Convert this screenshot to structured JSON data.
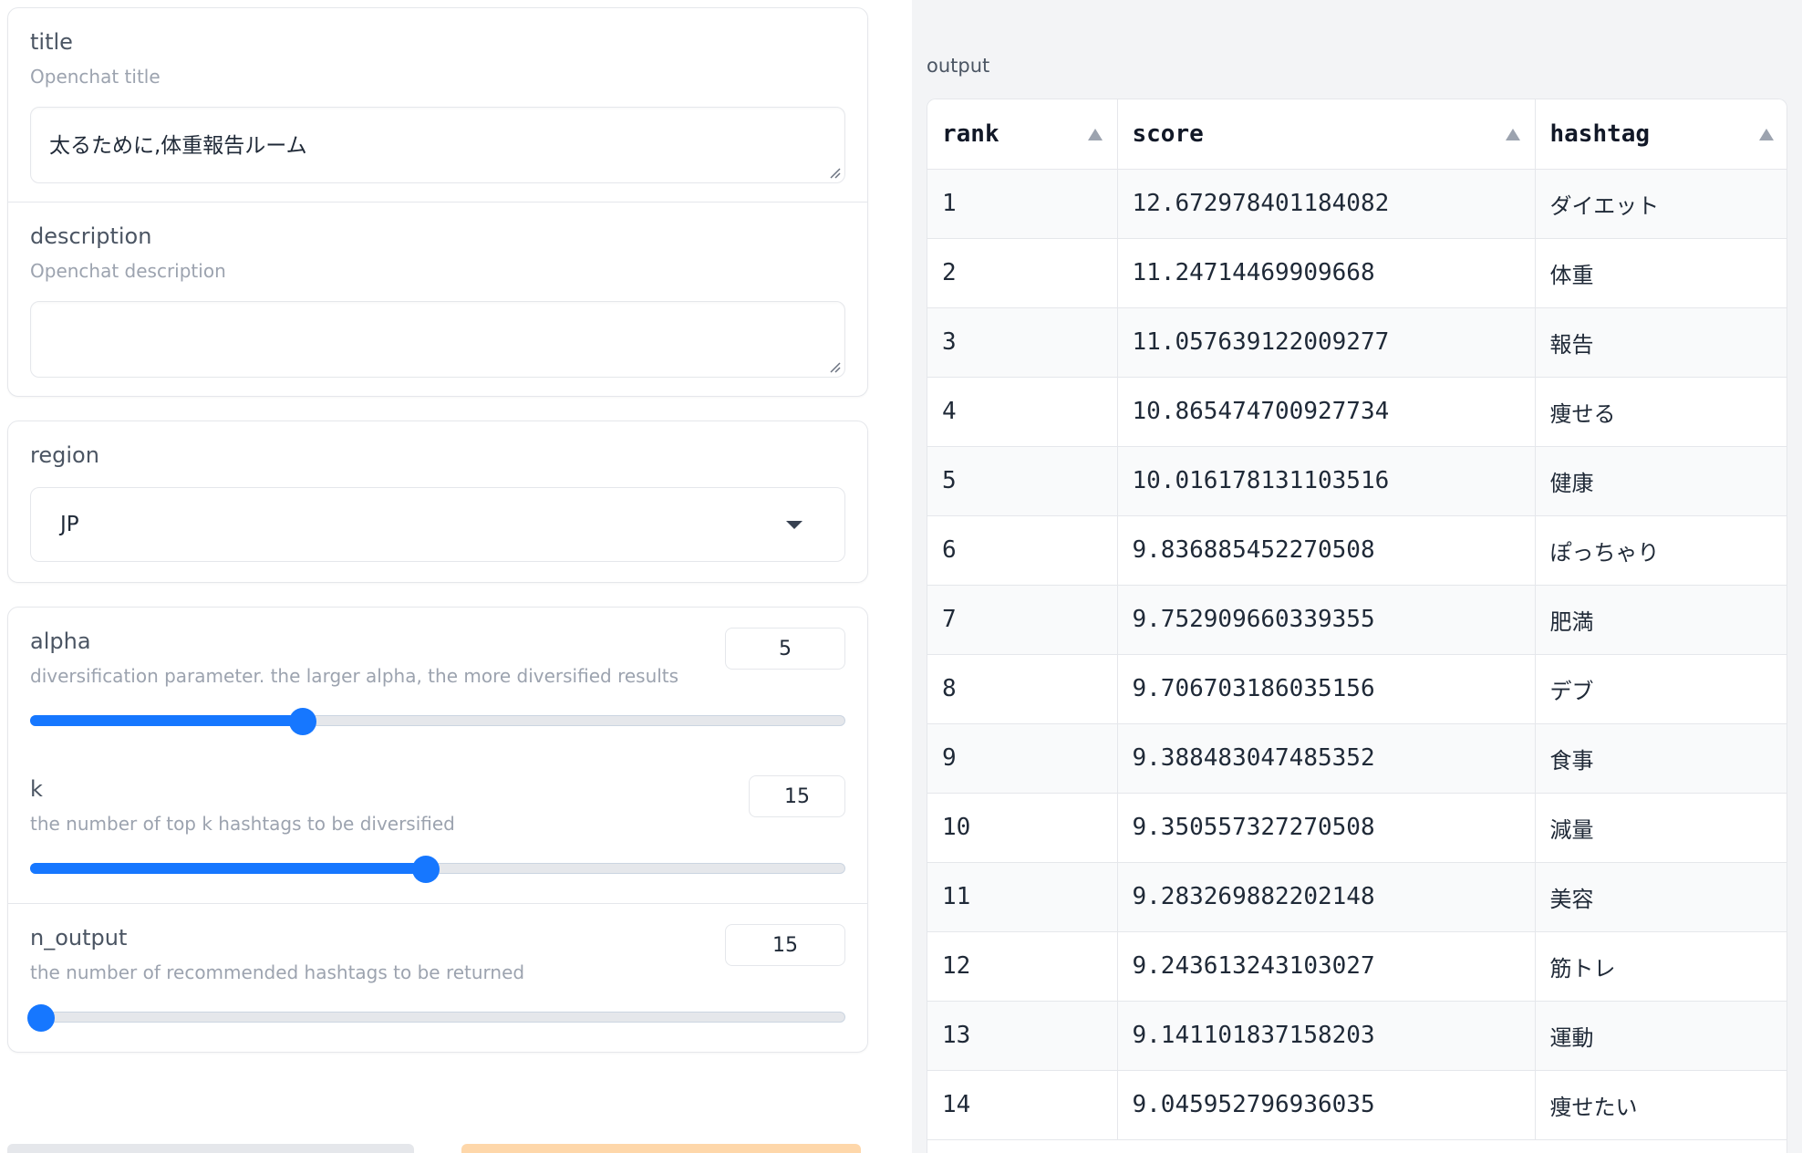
{
  "inputs": {
    "title": {
      "label": "title",
      "info": "Openchat title",
      "value": "太るために,体重報告ルーム"
    },
    "description": {
      "label": "description",
      "info": "Openchat description",
      "value": ""
    },
    "region": {
      "label": "region",
      "value": "JP"
    },
    "alpha": {
      "label": "alpha",
      "info": "diversification parameter. the larger alpha, the more diversified results",
      "value": "5",
      "fraction": 0.33
    },
    "k": {
      "label": "k",
      "info": "the number of top k hashtags to be diversified",
      "value": "15",
      "fraction": 0.485
    },
    "n_output": {
      "label": "n_output",
      "info": "the number of recommended hashtags to be returned",
      "value": "15",
      "fraction": 0.0
    }
  },
  "output": {
    "label": "output",
    "columns": [
      "rank",
      "score",
      "hashtag"
    ],
    "rows": [
      [
        "1",
        "12.672978401184082",
        "ダイエット"
      ],
      [
        "2",
        "11.24714469909668",
        "体重"
      ],
      [
        "3",
        "11.057639122009277",
        "報告"
      ],
      [
        "4",
        "10.865474700927734",
        "痩せる"
      ],
      [
        "5",
        "10.016178131103516",
        "健康"
      ],
      [
        "6",
        "9.836885452270508",
        "ぽっちゃり"
      ],
      [
        "7",
        "9.752909660339355",
        "肥満"
      ],
      [
        "8",
        "9.706703186035156",
        "デブ"
      ],
      [
        "9",
        "9.388483047485352",
        "食事"
      ],
      [
        "10",
        "9.350557327270508",
        "減量"
      ],
      [
        "11",
        "9.283269882202148",
        "美容"
      ],
      [
        "12",
        "9.243613243103027",
        "筋トレ"
      ],
      [
        "13",
        "9.141101837158203",
        "運動"
      ],
      [
        "14",
        "9.045952796936035",
        "痩せたい"
      ]
    ]
  },
  "colors": {
    "accent": "#1677ff",
    "border": "#e5e7eb",
    "panel_bg": "#f3f4f6"
  }
}
